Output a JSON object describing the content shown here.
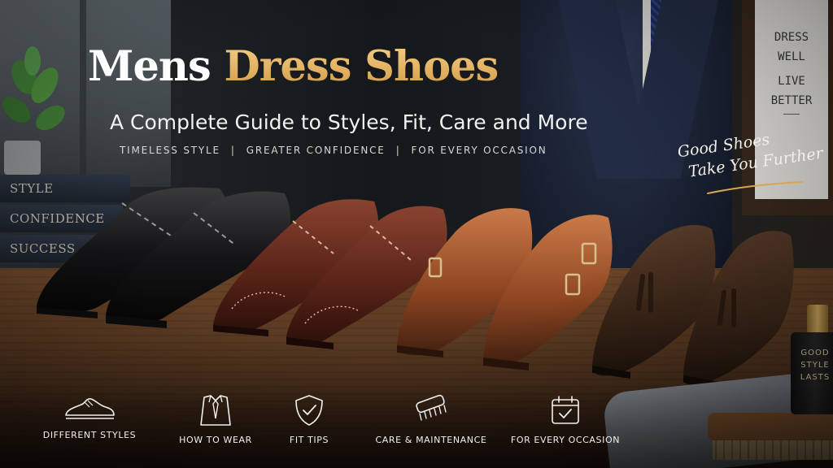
{
  "title": {
    "part1": "Mens ",
    "part2": "Dress Shoes"
  },
  "subtitle": "A Complete Guide to Styles, Fit, Care and More",
  "taglines": [
    "TIMELESS STYLE",
    "GREATER CONFIDENCE",
    "FOR EVERY OCCASION"
  ],
  "separator": "|",
  "script": {
    "line1": "Good Shoes",
    "line2": "Take You Further"
  },
  "books": [
    "STYLE",
    "CONFIDENCE",
    "SUCCESS"
  ],
  "sign": [
    "DRESS",
    "WELL",
    "LIVE",
    "BETTER"
  ],
  "bottle_label": [
    "GOOD",
    "STYLE",
    "LASTS"
  ],
  "features": [
    {
      "label": "DIFFERENT STYLES",
      "icon": "shoe-icon"
    },
    {
      "label": "HOW TO WEAR",
      "icon": "shirt-tie-icon"
    },
    {
      "label": "FIT TIPS",
      "icon": "shield-check-icon"
    },
    {
      "label": "CARE & MAINTENANCE",
      "icon": "brush-icon"
    },
    {
      "label": "FOR EVERY OCCASION",
      "icon": "calendar-check-icon"
    }
  ],
  "colors": {
    "gold": "#e5b25f",
    "white": "#ffffff",
    "wood": "#5a3a22"
  }
}
